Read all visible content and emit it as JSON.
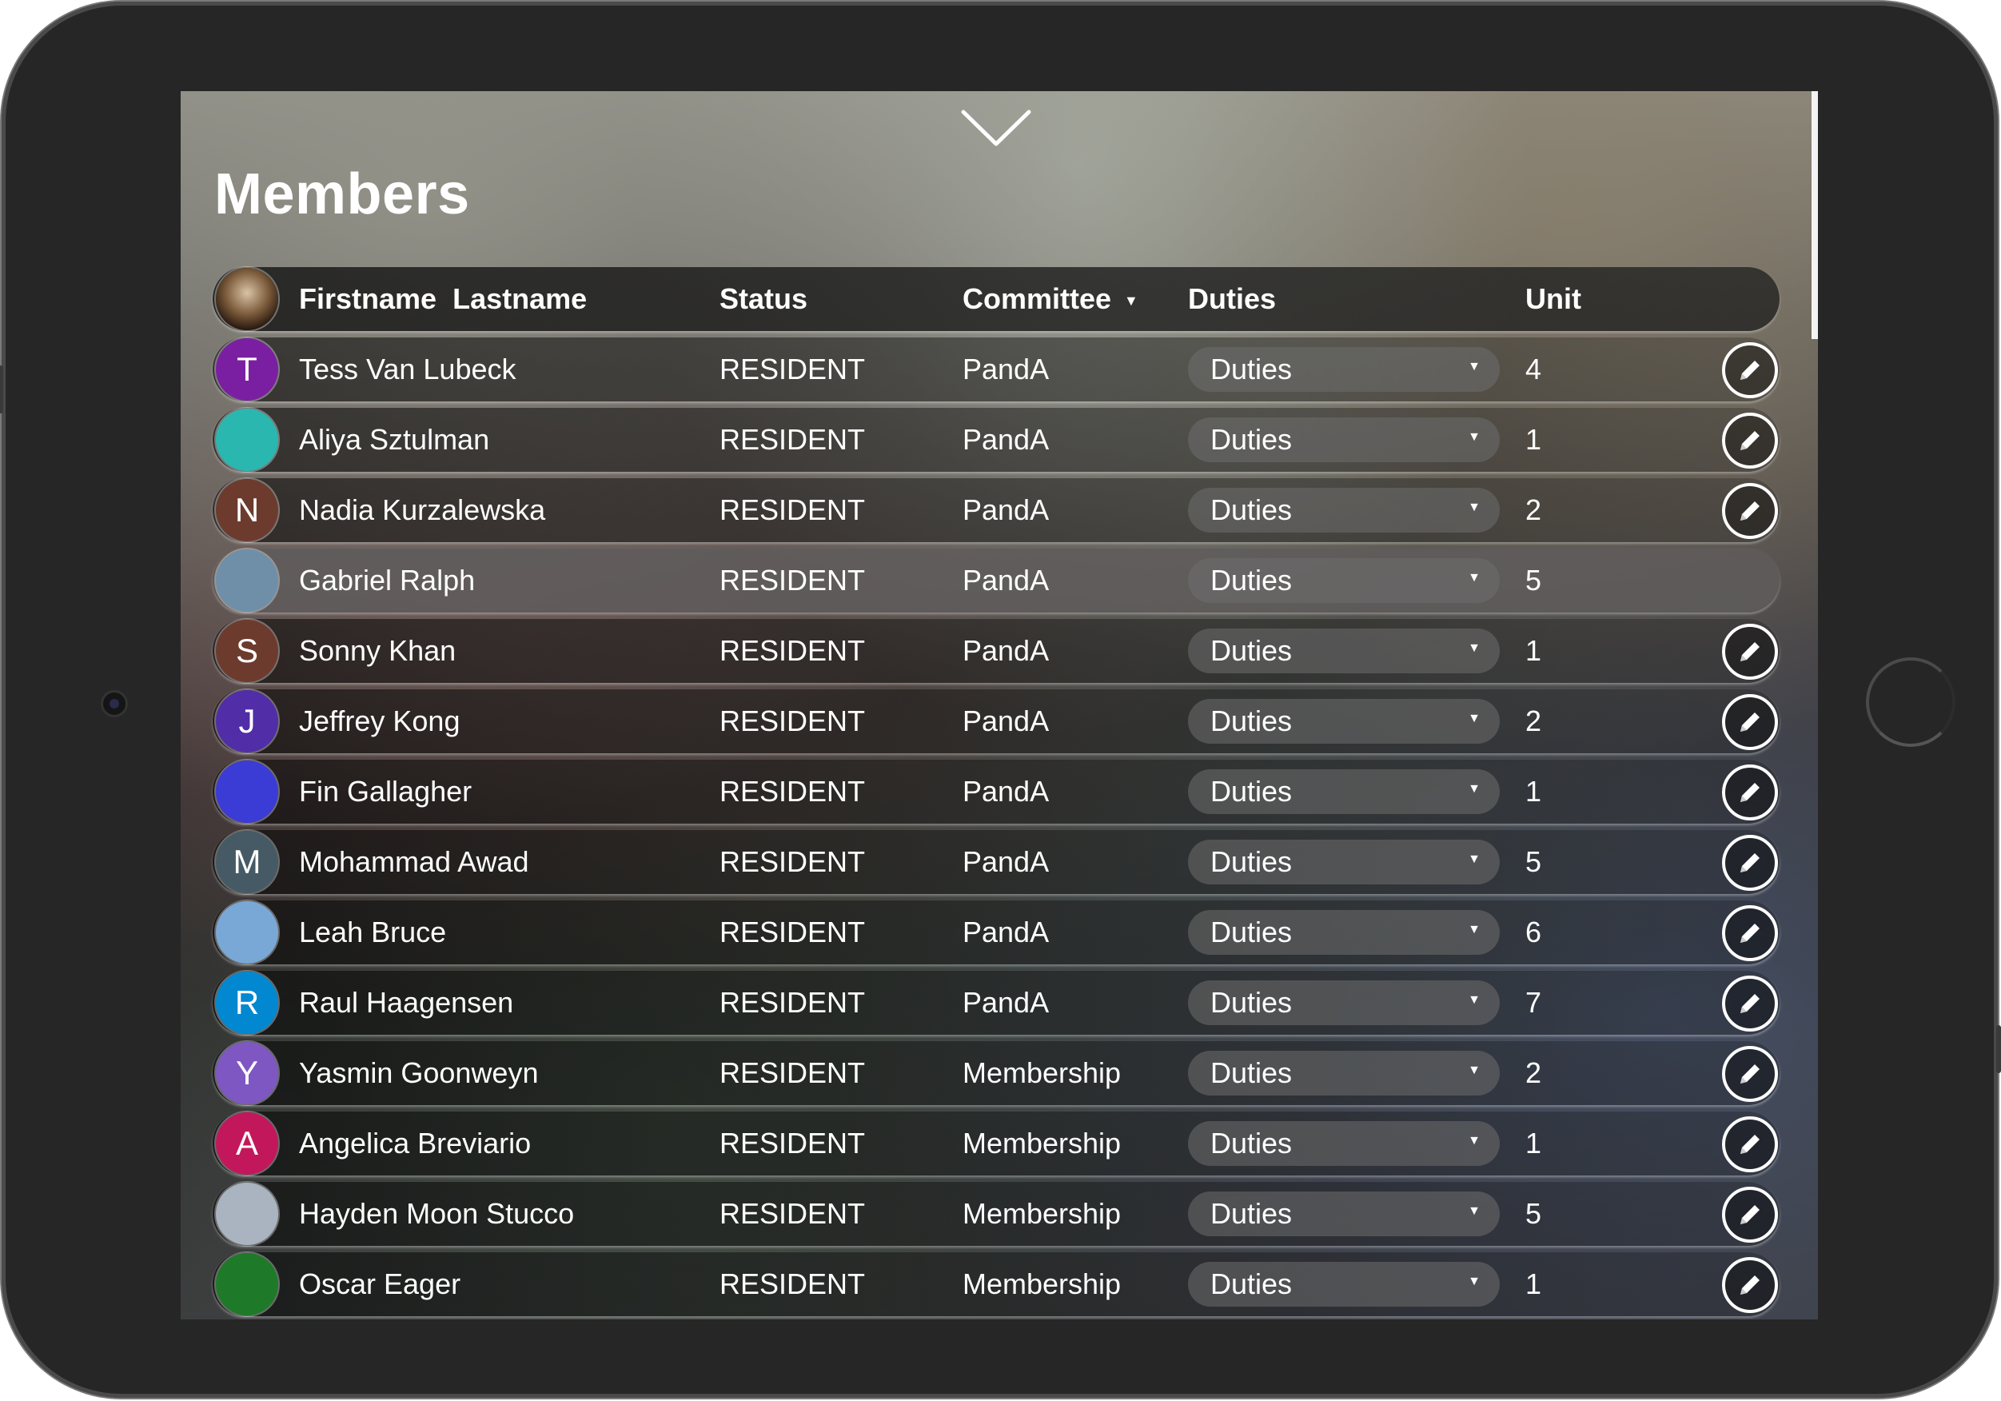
{
  "page": {
    "title": "Members"
  },
  "colors": {
    "device_frame": "#262626",
    "text": "#ffffff",
    "header_row": "#1e1e1e",
    "highlight_row": "#5f5c5c"
  },
  "icons": {
    "collapse": "chevron-down-icon",
    "edit": "pencil-icon",
    "sort": "caret-down-icon",
    "dropdown": "caret-down-icon"
  },
  "table": {
    "headers": {
      "firstname": "Firstname",
      "lastname": "Lastname",
      "status": "Status",
      "committee": "Committee",
      "duties": "Duties",
      "unit": "Unit"
    },
    "sort_column": "Committee",
    "rows": [
      {
        "initial": "T",
        "avatar_color": "#7b1fa2",
        "name": "Tess Van Lubeck",
        "status": "RESIDENT",
        "committee": "PandA",
        "duties": "Duties",
        "unit": "4",
        "editable": true
      },
      {
        "initial": "",
        "avatar_color": "#2ab7b0",
        "name": "Aliya Sztulman",
        "status": "RESIDENT",
        "committee": "PandA",
        "duties": "Duties",
        "unit": "1",
        "editable": true
      },
      {
        "initial": "N",
        "avatar_color": "#6d3b2e",
        "name": "Nadia Kurzalewska",
        "status": "RESIDENT",
        "committee": "PandA",
        "duties": "Duties",
        "unit": "2",
        "editable": true
      },
      {
        "initial": "",
        "avatar_color": "#6f8fa8",
        "name": "Gabriel Ralph",
        "status": "RESIDENT",
        "committee": "PandA",
        "duties": "Duties",
        "unit": "5",
        "editable": false
      },
      {
        "initial": "S",
        "avatar_color": "#6d3b2e",
        "name": "Sonny Khan",
        "status": "RESIDENT",
        "committee": "PandA",
        "duties": "Duties",
        "unit": "1",
        "editable": true
      },
      {
        "initial": "J",
        "avatar_color": "#512da8",
        "name": "Jeffrey Kong",
        "status": "RESIDENT",
        "committee": "PandA",
        "duties": "Duties",
        "unit": "2",
        "editable": true
      },
      {
        "initial": "",
        "avatar_color": "#3b3bd6",
        "name": "Fin Gallagher",
        "status": "RESIDENT",
        "committee": "PandA",
        "duties": "Duties",
        "unit": "1",
        "editable": true
      },
      {
        "initial": "M",
        "avatar_color": "#455a64",
        "name": "Mohammad Awad",
        "status": "RESIDENT",
        "committee": "PandA",
        "duties": "Duties",
        "unit": "5",
        "editable": true
      },
      {
        "initial": "",
        "avatar_color": "#7aa8d6",
        "name": "Leah Bruce",
        "status": "RESIDENT",
        "committee": "PandA",
        "duties": "Duties",
        "unit": "6",
        "editable": true
      },
      {
        "initial": "R",
        "avatar_color": "#0288d1",
        "name": "Raul Haagensen",
        "status": "RESIDENT",
        "committee": "PandA",
        "duties": "Duties",
        "unit": "7",
        "editable": true
      },
      {
        "initial": "Y",
        "avatar_color": "#7e57c2",
        "name": "Yasmin Goonweyn",
        "status": "RESIDENT",
        "committee": "Membership",
        "duties": "Duties",
        "unit": "2",
        "editable": true
      },
      {
        "initial": "A",
        "avatar_color": "#c2185b",
        "name": "Angelica Breviario",
        "status": "RESIDENT",
        "committee": "Membership",
        "duties": "Duties",
        "unit": "1",
        "editable": true
      },
      {
        "initial": "",
        "avatar_color": "#a9b4c0",
        "name": "Hayden Moon Stucco",
        "status": "RESIDENT",
        "committee": "Membership",
        "duties": "Duties",
        "unit": "5",
        "editable": true
      },
      {
        "initial": "",
        "avatar_color": "#1e7a28",
        "name": "Oscar Eager",
        "status": "RESIDENT",
        "committee": "Membership",
        "duties": "Duties",
        "unit": "1",
        "editable": true
      }
    ]
  }
}
